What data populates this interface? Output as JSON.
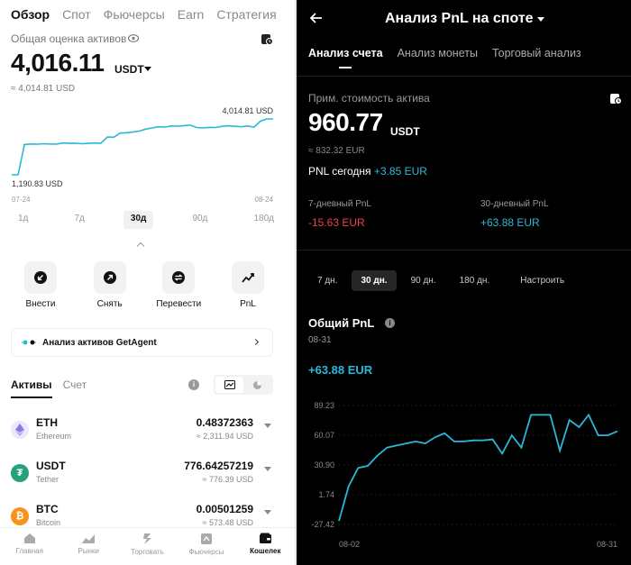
{
  "left": {
    "top_tabs": [
      "Обзор",
      "Спот",
      "Фьючерсы",
      "Earn",
      "Стратегия"
    ],
    "estimate_label": "Общая оценка активов",
    "total_value": "4,016.11",
    "total_unit": "USDT",
    "approx_value": "≈ 4,014.81 USD",
    "chart_data": {
      "type": "line",
      "x_start_label": "07-24",
      "x_end_label": "08-24",
      "max_label": "4,014.81 USD",
      "min_label": "1,190.83 USD",
      "ylim": [
        1190.83,
        4014.81
      ],
      "values": [
        1190.83,
        1190.83,
        2720,
        2750,
        2740,
        2760,
        2750,
        2745,
        2800,
        2780,
        2790,
        2760,
        2780,
        2800,
        2790,
        3100,
        3090,
        3300,
        3320,
        3350,
        3400,
        3500,
        3560,
        3620,
        3600,
        3660,
        3650,
        3680,
        3700,
        3580,
        3560,
        3590,
        3580,
        3640,
        3670,
        3640,
        3620,
        3660,
        3600,
        3900,
        4014.81,
        4014.81
      ],
      "color": "#2bb8d8"
    },
    "ranges": [
      "1д",
      "7д",
      "30д",
      "90д",
      "180д"
    ],
    "active_range": "30д",
    "actions": [
      {
        "label": "Внести",
        "icon": "deposit-icon"
      },
      {
        "label": "Снять",
        "icon": "withdraw-icon"
      },
      {
        "label": "Перевести",
        "icon": "transfer-icon"
      },
      {
        "label": "PnL",
        "icon": "pnl-icon"
      }
    ],
    "agent_banner": "Анализ активов GetAgent",
    "asset_tabs": [
      "Активы",
      "Счет"
    ],
    "assets": [
      {
        "symbol": "ETH",
        "name": "Ethereum",
        "amount": "0.48372363",
        "usd": "≈ 2,311.94 USD",
        "color": "#b8a4f0"
      },
      {
        "symbol": "USDT",
        "name": "Tether",
        "amount": "776.64257219",
        "usd": "≈ 776.39 USD",
        "color": "#26a17b"
      },
      {
        "symbol": "BTC",
        "name": "Bitcoin",
        "amount": "0.00501259",
        "usd": "≈ 573.48 USD",
        "color": "#f7931a"
      }
    ],
    "nav": [
      {
        "label": "Главная",
        "icon": "home-icon"
      },
      {
        "label": "Рынки",
        "icon": "markets-icon"
      },
      {
        "label": "Торговать",
        "icon": "trade-icon"
      },
      {
        "label": "Фьючерсы",
        "icon": "futures-icon"
      },
      {
        "label": "Кошелек",
        "icon": "wallet-icon"
      }
    ],
    "active_nav": "Кошелек"
  },
  "right": {
    "title": "Анализ PnL на споте",
    "tabs": [
      "Анализ счета",
      "Анализ монеты",
      "Торговый анализ"
    ],
    "est_label": "Прим. стоимость актива",
    "value": "960.77",
    "unit": "USDT",
    "approx": "≈ 832.32 EUR",
    "pnl_today_label": "PNL сегодня",
    "pnl_today_value": "+3.85 EUR",
    "pnl7_label": "7-дневный PnL",
    "pnl7_value": "-15.63 EUR",
    "pnl30_label": "30-дневный PnL",
    "pnl30_value": "+63.88 EUR",
    "periods": [
      "7 дн.",
      "30 дн.",
      "90 дн.",
      "180 дн.",
      "Настроить"
    ],
    "active_period": "30 дн.",
    "total_label": "Общий PnL",
    "date": "08-31",
    "total_value": "+63.88 EUR",
    "chart_data": {
      "type": "line",
      "y_ticks": [
        "89.23",
        "60.07",
        "30.90",
        "1.74",
        "-27.42"
      ],
      "ylim": [
        -27.42,
        89.23
      ],
      "x_start_label": "08-02",
      "x_end_label": "08-31",
      "x": [
        "08-02",
        "08-03",
        "08-04",
        "08-05",
        "08-06",
        "08-07",
        "08-08",
        "08-09",
        "08-10",
        "08-11",
        "08-12",
        "08-13",
        "08-14",
        "08-15",
        "08-16",
        "08-17",
        "08-18",
        "08-19",
        "08-20",
        "08-21",
        "08-22",
        "08-23",
        "08-24",
        "08-25",
        "08-26",
        "08-27",
        "08-28",
        "08-29",
        "08-30",
        "08-31"
      ],
      "values": [
        -24,
        10,
        28,
        30,
        40,
        48,
        50,
        52,
        54,
        52,
        58,
        62,
        54,
        54,
        55,
        55,
        56,
        42,
        60,
        48,
        80,
        80,
        80,
        45,
        75,
        68,
        80,
        60,
        60,
        64
      ],
      "color": "#2bb8d8"
    }
  }
}
